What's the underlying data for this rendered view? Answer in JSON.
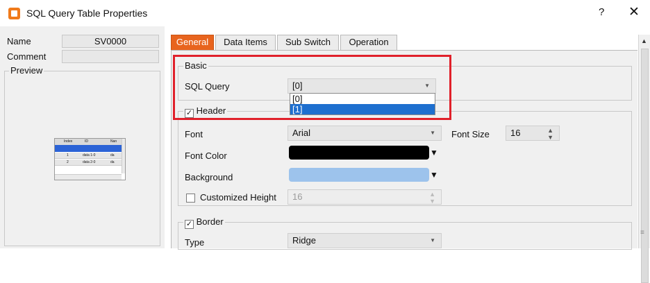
{
  "window": {
    "title": "SQL Query Table Properties",
    "help": "?",
    "close": "✕"
  },
  "left": {
    "name_label": "Name",
    "name_value": "SV0000",
    "comment_label": "Comment",
    "comment_value": "",
    "preview_label": "Preview",
    "preview_table": {
      "headers": [
        "Index",
        "ID",
        "Nan"
      ],
      "rows": [
        [
          "1",
          "data 1-0",
          "da"
        ],
        [
          "2",
          "data 2-0",
          "da"
        ]
      ]
    }
  },
  "tabs": [
    {
      "label": "General",
      "active": true
    },
    {
      "label": "Data Items",
      "active": false
    },
    {
      "label": "Sub Switch",
      "active": false
    },
    {
      "label": "Operation",
      "active": false
    }
  ],
  "basic": {
    "group": "Basic",
    "sql_query_label": "SQL Query",
    "sql_query_value": "[0]",
    "options": [
      "[0]",
      "[1]"
    ],
    "highlighted_option": "[1]"
  },
  "header": {
    "group": "Header",
    "checked": true,
    "font_label": "Font",
    "font_value": "Arial",
    "font_size_label": "Font Size",
    "font_size_value": "16",
    "font_color_label": "Font Color",
    "font_color": "#000000",
    "background_label": "Background",
    "background_color": "#9dc3ec",
    "custom_height_label": "Customized Height",
    "custom_height_checked": false,
    "custom_height_value": "16"
  },
  "border": {
    "group": "Border",
    "checked": true,
    "type_label": "Type",
    "type_value": "Ridge"
  },
  "colors": {
    "accent_tab": "#e8641e",
    "highlight": "#e0202a",
    "selection": "#1e6fcf"
  }
}
